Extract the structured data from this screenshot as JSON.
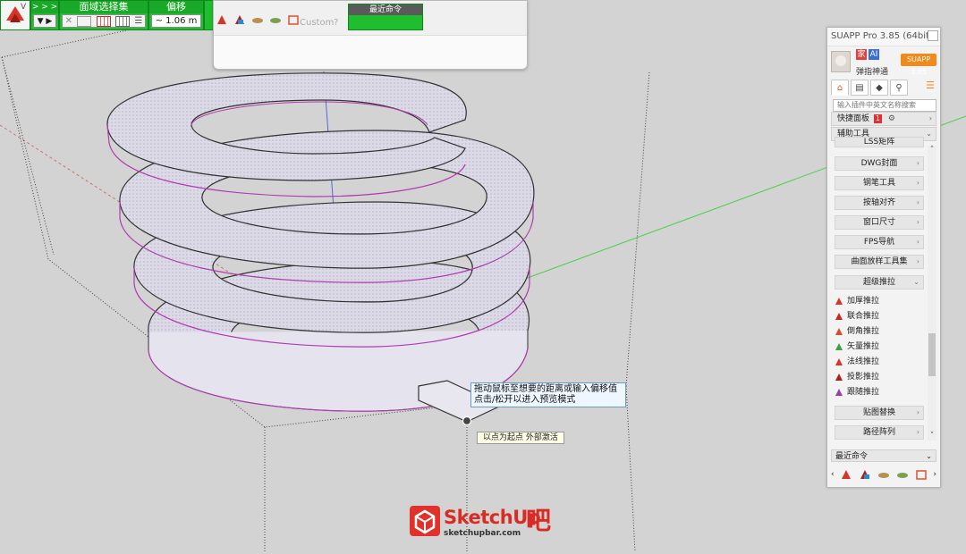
{
  "toolbar": {
    "logo_letter": "V",
    "nav_arrows": "> > >",
    "nav_down": "▼ ▶",
    "face_select_title": "面域选择集",
    "offset_title": "偏移",
    "offset_value": "~ 1.06 m",
    "recent_title": "最近命令",
    "custom_label": "Custom"
  },
  "tooltip": {
    "main_line1": "拖动鼠标至想要的距离或输入偏移值",
    "main_line2": "点击/松开以进入预览模式",
    "point_hint": "以点为起点 外部激活"
  },
  "panel": {
    "title": "SUAPP Pro 3.85 (64bit)",
    "badge_left": "家",
    "badge_right": "AI",
    "username": "弹指神通",
    "version_badge": "SUAPP 3.85",
    "search_placeholder": "输入插件中英文名称搜索",
    "quick_panel": "快捷面板",
    "quick_count": "1",
    "aux_tools": "辅助工具",
    "items": [
      {
        "label": "LSS矩阵"
      },
      {
        "label": "DWG封面"
      },
      {
        "label": "钢笔工具"
      },
      {
        "label": "按轴对齐"
      },
      {
        "label": "窗口尺寸"
      },
      {
        "label": "FPS导航"
      },
      {
        "label": "曲面放样工具集"
      },
      {
        "label": "超级推拉"
      }
    ],
    "subitems": [
      {
        "label": "加厚推拉"
      },
      {
        "label": "联合推拉"
      },
      {
        "label": "倒角推拉"
      },
      {
        "label": "矢量推拉"
      },
      {
        "label": "法线推拉"
      },
      {
        "label": "投影推拉"
      },
      {
        "label": "跟随推拉"
      }
    ],
    "items2": [
      {
        "label": "贴图替换"
      },
      {
        "label": "路径阵列"
      }
    ],
    "recent": "最近命令"
  },
  "watermark": {
    "name": "SketchUp",
    "suffix": "吧",
    "url": "sketchupbar.com"
  },
  "colors": {
    "toolbar_green": "#1fbd2f",
    "surface": "#d8d6e3",
    "edge_magenta": "#b23bb0",
    "axis_blue": "#2b3dd8",
    "axis_green": "#23b023",
    "axis_red": "#d03030",
    "accent_orange": "#f08a1a",
    "brand_red": "#d92b24"
  }
}
